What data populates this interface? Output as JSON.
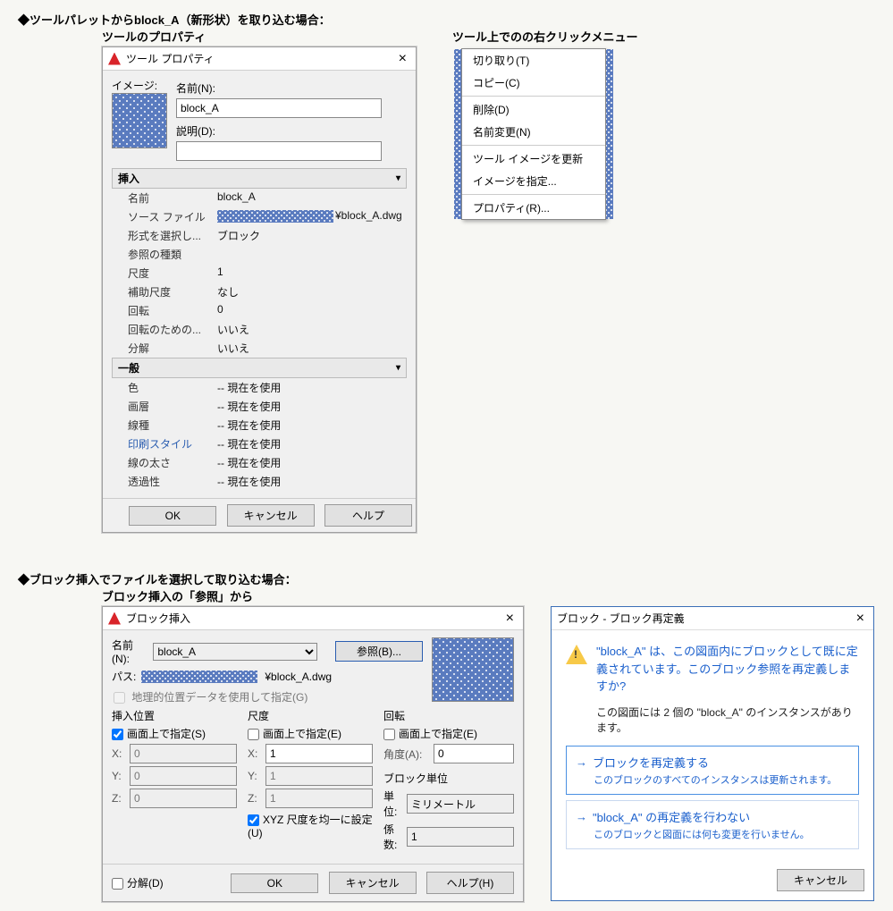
{
  "section1": {
    "title": "◆ツールパレットからblock_A（新形状）を取り込む場合：",
    "leftLabel": "ツールのプロパティ",
    "rightLabel": "ツール上でのの右クリックメニュー"
  },
  "toolProps": {
    "title": "ツール プロパティ",
    "imageLabel": "イメージ:",
    "nameLabel": "名前(N):",
    "nameValue": "block_A",
    "descLabel": "説明(D):",
    "descValue": "",
    "groups": {
      "insert": {
        "head": "挿入",
        "rows": [
          {
            "k": "名前",
            "v": "block_A"
          },
          {
            "k": "ソース ファイル",
            "v": "¥block_A.dwg",
            "src": true
          },
          {
            "k": "形式を選択し...",
            "v": "ブロック"
          },
          {
            "k": "参照の種類",
            "v": ""
          },
          {
            "k": "尺度",
            "v": "1"
          },
          {
            "k": "補助尺度",
            "v": "なし"
          },
          {
            "k": "回転",
            "v": "0"
          },
          {
            "k": "回転のための...",
            "v": "いいえ"
          },
          {
            "k": "分解",
            "v": "いいえ"
          }
        ]
      },
      "general": {
        "head": "一般",
        "rows": [
          {
            "k": "色",
            "v": "-- 現在を使用"
          },
          {
            "k": "画層",
            "v": "-- 現在を使用"
          },
          {
            "k": "線種",
            "v": "-- 現在を使用"
          },
          {
            "k": "印刷スタイル",
            "v": "-- 現在を使用",
            "blue": true
          },
          {
            "k": "線の太さ",
            "v": "-- 現在を使用"
          },
          {
            "k": "透過性",
            "v": "-- 現在を使用"
          }
        ]
      }
    },
    "ok": "OK",
    "cancel": "キャンセル",
    "help": "ヘルプ"
  },
  "ctxMenu": {
    "items": [
      "切り取り(T)",
      "コピー(C)",
      "-",
      "削除(D)",
      "名前変更(N)",
      "-",
      "ツール イメージを更新",
      "イメージを指定...",
      "-",
      "プロパティ(R)..."
    ]
  },
  "section2": {
    "title": "◆ブロック挿入でファイルを選択して取り込む場合：",
    "sub": "ブロック挿入の「参照」から"
  },
  "blockInsert": {
    "title": "ブロック挿入",
    "nameLabel": "名前(N):",
    "nameValue": "block_A",
    "browse": "参照(B)...",
    "pathLabel": "パス:",
    "pathValue": "¥block_A.dwg",
    "geo": "地理的位置データを使用して指定(G)",
    "cols": {
      "pos": {
        "head": "挿入位置",
        "chk": "画面上で指定(S)",
        "x": "0",
        "y": "0",
        "z": "0"
      },
      "scale": {
        "head": "尺度",
        "chk": "画面上で指定(E)",
        "x": "1",
        "y": "1",
        "z": "1",
        "uni": "XYZ 尺度を均一に設定(U)"
      },
      "rot": {
        "head": "回転",
        "chk": "画面上で指定(E)",
        "angLabel": "角度(A):",
        "ang": "0",
        "unitHead": "ブロック単位",
        "unitLabel": "単位:",
        "unitVal": "ミリメートル",
        "factorLabel": "係数:",
        "factorVal": "1"
      }
    },
    "explode": "分解(D)",
    "ok": "OK",
    "cancel": "キャンセル",
    "help": "ヘルプ(H)"
  },
  "redef": {
    "title": "ブロック - ブロック再定義",
    "msg1": "\"block_A\" は、この図面内にブロックとして既に定義されています。このブロック参照を再定義しますか?",
    "info": "この図面には 2 個の \"block_A\" のインスタンスがあります。",
    "opt1": {
      "h": "ブロックを再定義する",
      "s": "このブロックのすべてのインスタンスは更新されます。"
    },
    "opt2": {
      "h": "\"block_A\" の再定義を行わない",
      "s": "このブロックと図面には何も変更を行いません。"
    },
    "cancel": "キャンセル"
  }
}
